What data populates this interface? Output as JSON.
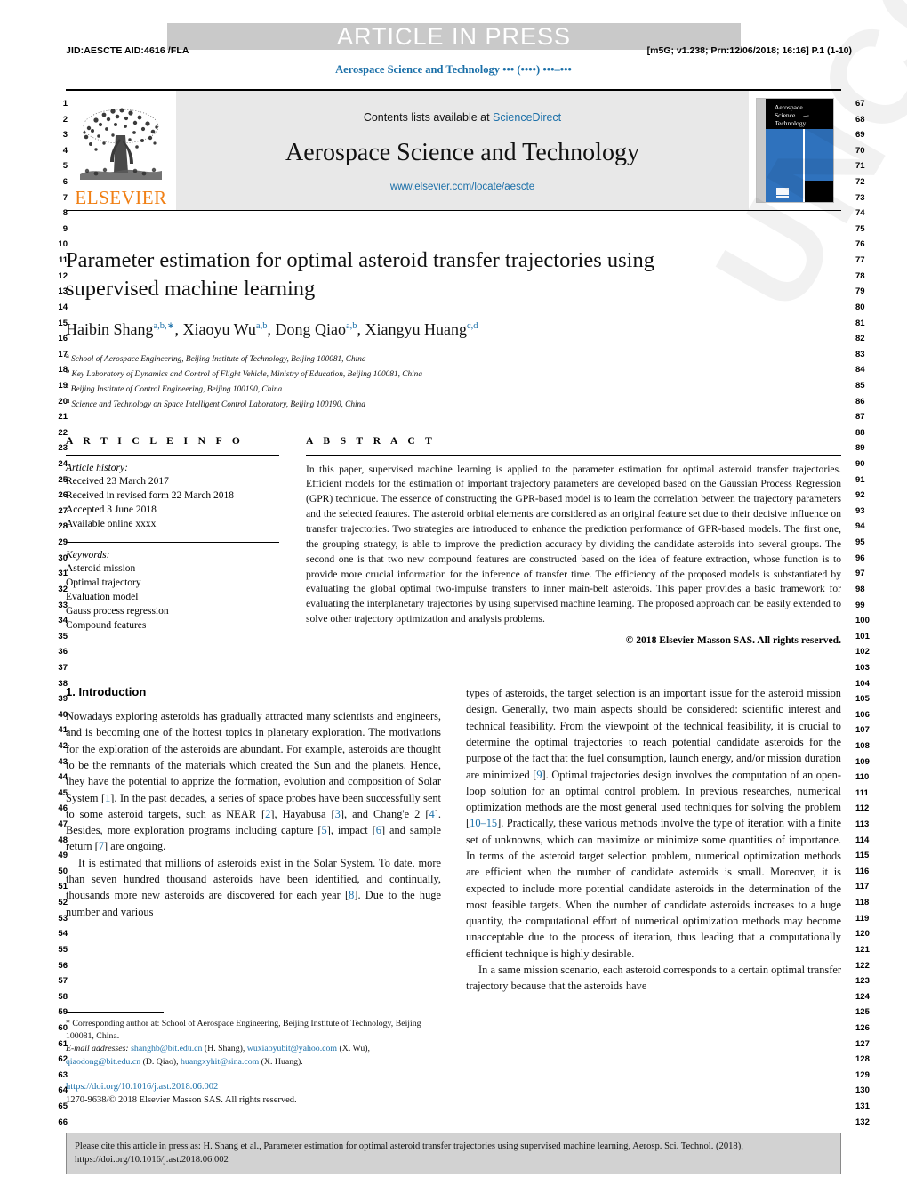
{
  "banner": {
    "text": "ARTICLE IN PRESS"
  },
  "meta": {
    "jid_left": "JID:AESCTE   AID:4616 /FLA",
    "jid_right": "[m5G; v1.238; Prn:12/06/2018; 16:16] P.1 (1-10)",
    "running_head": "Aerospace Science and Technology ••• (••••) •••–•••"
  },
  "masthead": {
    "contents_prefix": "Contents lists available at ",
    "contents_link": "ScienceDirect",
    "journal_title": "Aerospace Science and Technology",
    "journal_url": "www.elsevier.com/locate/aescte",
    "publisher_word": "ELSEVIER",
    "publisher_logo_icon": "elsevier-tree-icon",
    "cover_line1": "Aerospace",
    "cover_line2": "Science",
    "cover_line3": "and",
    "cover_line4": "Technology",
    "cover_accent": "#2f72bd"
  },
  "article": {
    "title": "Parameter estimation for optimal asteroid transfer trajectories using supervised machine learning",
    "authors": [
      {
        "name": "Haibin Shang",
        "sup": "a,b,∗",
        "sep": ", "
      },
      {
        "name": "Xiaoyu Wu",
        "sup": "a,b",
        "sep": ", "
      },
      {
        "name": "Dong Qiao",
        "sup": "a,b",
        "sep": ", "
      },
      {
        "name": "Xiangyu Huang",
        "sup": "c,d",
        "sep": ""
      }
    ],
    "affiliations": [
      {
        "sup": "a",
        "text": "School of Aerospace Engineering, Beijing Institute of Technology, Beijing 100081, China"
      },
      {
        "sup": "b",
        "text": "Key Laboratory of Dynamics and Control of Flight Vehicle, Ministry of Education, Beijing 100081, China"
      },
      {
        "sup": "c",
        "text": "Beijing Institute of Control Engineering, Beijing 100190, China"
      },
      {
        "sup": "d",
        "text": "Science and Technology on Space Intelligent Control Laboratory, Beijing 100190, China"
      }
    ]
  },
  "article_info": {
    "heading": "A R T I C L E    I N F O",
    "history_label": "Article history:",
    "history": [
      "Received 23 March 2017",
      "Received in revised form 22 March 2018",
      "Accepted 3 June 2018",
      "Available online xxxx"
    ],
    "keywords_label": "Keywords:",
    "keywords": [
      "Asteroid mission",
      "Optimal trajectory",
      "Evaluation model",
      "Gauss process regression",
      "Compound features"
    ]
  },
  "abstract": {
    "heading": "A B S T R A C T",
    "text": "In this paper, supervised machine learning is applied to the parameter estimation for optimal asteroid transfer trajectories. Efficient models for the estimation of important trajectory parameters are developed based on the Gaussian Process Regression (GPR) technique. The essence of constructing the GPR-based model is to learn the correlation between the trajectory parameters and the selected features. The asteroid orbital elements are considered as an original feature set due to their decisive influence on transfer trajectories. Two strategies are introduced to enhance the prediction performance of GPR-based models. The first one, the grouping strategy, is able to improve the prediction accuracy by dividing the candidate asteroids into several groups. The second one is that two new compound features are constructed based on the idea of feature extraction, whose function is to provide more crucial information for the inference of transfer time. The efficiency of the proposed models is substantiated by evaluating the global optimal two-impulse transfers to inner main-belt asteroids. This paper provides a basic framework for evaluating the interplanetary trajectories by using supervised machine learning. The proposed approach can be easily extended to solve other trajectory optimization and analysis problems.",
    "copyright": "© 2018 Elsevier Masson SAS. All rights reserved."
  },
  "body": {
    "section_title": "1. Introduction",
    "left_paragraphs": [
      "Nowadays exploring asteroids has gradually attracted many scientists and engineers, and is becoming one of the hottest topics in planetary exploration. The motivations for the exploration of the asteroids are abundant. For example, asteroids are thought to be the remnants of the materials which created the Sun and the planets. Hence, they have the potential to apprize the formation, evolution and composition of Solar System [1]. In the past decades, a series of space probes have been successfully sent to some asteroid targets, such as NEAR [2], Hayabusa [3], and Chang'e 2 [4]. Besides, more exploration programs including capture [5], impact [6] and sample return [7] are ongoing.",
      "It is estimated that millions of asteroids exist in the Solar System. To date, more than seven hundred thousand asteroids have been identified, and continually, thousands more new asteroids are discovered for each year [8]. Due to the huge number and various"
    ],
    "right_paragraphs": [
      "types of asteroids, the target selection is an important issue for the asteroid mission design. Generally, two main aspects should be considered: scientific interest and technical feasibility. From the viewpoint of the technical feasibility, it is crucial to determine the optimal trajectories to reach potential candidate asteroids for the purpose of the fact that the fuel consumption, launch energy, and/or mission duration are minimized [9]. Optimal trajectories design involves the computation of an open-loop solution for an optimal control problem. In previous researches, numerical optimization methods are the most general used techniques for solving the problem [10–15]. Practically, these various methods involve the type of iteration with a finite set of unknowns, which can maximize or minimize some quantities of importance. In terms of the asteroid target selection problem, numerical optimization methods are efficient when the number of candidate asteroids is small. Moreover, it is expected to include more potential candidate asteroids in the determination of the most feasible targets. When the number of candidate asteroids increases to a huge quantity, the computational effort of numerical optimization methods may become unacceptable due to the process of iteration, thus leading that a computationally efficient technique is highly desirable.",
      "In a same mission scenario, each asteroid corresponds to a certain optimal transfer trajectory because that the asteroids have"
    ]
  },
  "footnote": {
    "corresponding": "* Corresponding author at: School of Aerospace Engineering, Beijing Institute of Technology, Beijing 100081, China.",
    "email_label": "E-mail addresses:",
    "emails": [
      {
        "address": "shanghb@bit.edu.cn",
        "owner": " (H. Shang), "
      },
      {
        "address": "wuxiaoyubit@yahoo.com",
        "owner": " (X. Wu), "
      },
      {
        "address": "qiaodong@bit.edu.cn",
        "owner": " (D. Qiao), "
      },
      {
        "address": "huangxyhit@sina.com",
        "owner": " (X. Huang)."
      }
    ],
    "doi": "https://doi.org/10.1016/j.ast.2018.06.002",
    "issn": "1270-9638/© 2018 Elsevier Masson SAS. All rights reserved."
  },
  "cite_footer": {
    "text": "Please cite this article in press as: H. Shang et al., Parameter estimation for optimal asteroid transfer trajectories using supervised machine learning, Aerosp. Sci. Technol. (2018), https://doi.org/10.1016/j.ast.2018.06.002"
  },
  "line_numbers": {
    "left_start": 1,
    "right_start": 67,
    "count": 66
  },
  "watermark": {
    "text": "UNCORRECTED PROOF"
  },
  "colors": {
    "link": "#1a6fa8",
    "elsevier_orange": "#f07f14",
    "banner_grey": "#c9c9c9",
    "contents_grey": "#e8e8e8",
    "footer_grey": "#d2d2d2"
  }
}
